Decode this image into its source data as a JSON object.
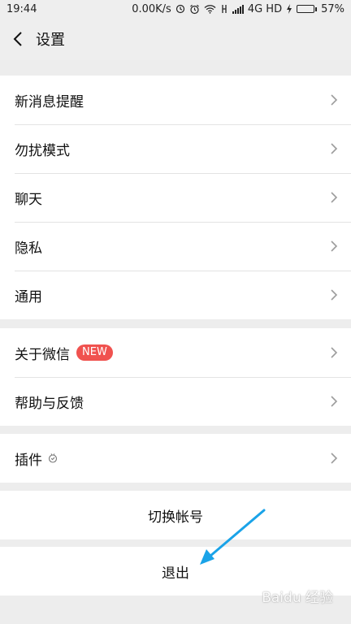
{
  "status_bar": {
    "time": "19:44",
    "speed": "0.00K/s",
    "network": "4G HD",
    "battery": "57%",
    "battery_level": 0.57,
    "icons": [
      "clock-icon",
      "alarm-icon",
      "wifi-icon",
      "sim-icon",
      "signal-icon",
      "charging-icon"
    ]
  },
  "header": {
    "title": "设置",
    "back_icon": "chevron-left-icon"
  },
  "groups": {
    "main": [
      {
        "label": "新消息提醒"
      },
      {
        "label": "勿扰模式"
      },
      {
        "label": "聊天"
      },
      {
        "label": "隐私"
      },
      {
        "label": "通用"
      }
    ],
    "about": [
      {
        "label": "关于微信",
        "badge": "NEW"
      },
      {
        "label": "帮助与反馈"
      }
    ],
    "plugins": [
      {
        "label": "插件"
      }
    ]
  },
  "actions": {
    "switch_account": "切换帐号",
    "logout": "退出"
  },
  "watermark": "Baidu 经验",
  "colors": {
    "badge": "#f0524f",
    "arrow": "#1aa3e8",
    "battery": "#39b54a",
    "background": "#ededed"
  }
}
